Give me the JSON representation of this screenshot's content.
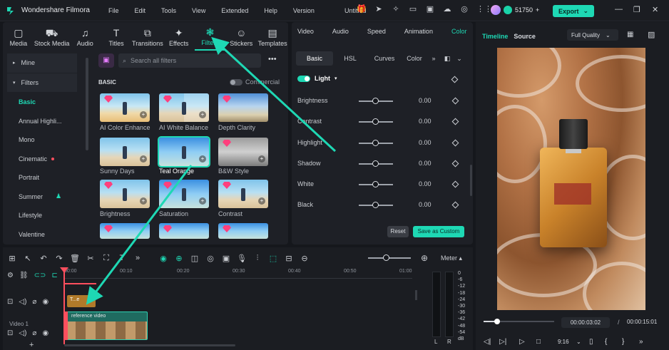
{
  "titlebar": {
    "app_name": "Wondershare Filmora",
    "menu": [
      "File",
      "Edit",
      "Tools",
      "View",
      "Extended",
      "Help",
      "Version"
    ],
    "doc_title": "Untitled",
    "credits": "51750",
    "export_label": "Export"
  },
  "media_tabs": [
    {
      "label": "Media",
      "icon": "media-icon"
    },
    {
      "label": "Stock Media",
      "icon": "stock-media-icon"
    },
    {
      "label": "Audio",
      "icon": "audio-icon"
    },
    {
      "label": "Titles",
      "icon": "titles-icon"
    },
    {
      "label": "Transitions",
      "icon": "transitions-icon"
    },
    {
      "label": "Effects",
      "icon": "effects-icon"
    },
    {
      "label": "Filters",
      "icon": "filters-icon"
    },
    {
      "label": "Stickers",
      "icon": "stickers-icon"
    },
    {
      "label": "Templates",
      "icon": "templates-icon"
    }
  ],
  "sidebar": {
    "mine": "Mine",
    "filters": "Filters",
    "items": [
      "Basic",
      "Annual Highli...",
      "Mono",
      "Cinematic",
      "Portrait",
      "Summer",
      "Lifestyle",
      "Valentine"
    ]
  },
  "filters_panel": {
    "search_placeholder": "Search all filters",
    "section": "BASIC",
    "commercial": "Commercial",
    "thumbs": [
      "AI Color Enhance",
      "AI White Balance",
      "Depth Clarity",
      "Sunny Days",
      "Teal Orange",
      "B&W Style",
      "Brightness",
      "Saturation",
      "Contrast"
    ]
  },
  "inspector": {
    "tabs": [
      "Video",
      "Audio",
      "Speed",
      "Animation",
      "Color"
    ],
    "sub_tabs": [
      "Basic",
      "HSL",
      "Curves",
      "Color"
    ],
    "light_label": "Light",
    "adjustments": [
      {
        "label": "Brightness",
        "value": "0.00"
      },
      {
        "label": "Contrast",
        "value": "0.00"
      },
      {
        "label": "Highlight",
        "value": "0.00"
      },
      {
        "label": "Shadow",
        "value": "0.00"
      },
      {
        "label": "White",
        "value": "0.00"
      },
      {
        "label": "Black",
        "value": "0.00"
      }
    ],
    "reset_label": "Reset",
    "save_custom_label": "Save as Custom"
  },
  "preview": {
    "tab_timeline": "Timeline",
    "tab_source": "Source",
    "quality": "Full Quality",
    "time_current": "00:00:03:02",
    "time_sep": "/",
    "time_total": "00:00:15:01",
    "aspect": "9:16",
    "progress": 0.2
  },
  "timeline": {
    "meter_label": "Meter",
    "ruler": [
      "00:00",
      "00:10",
      "00:20",
      "00:30",
      "00:40",
      "00:50",
      "01:00"
    ],
    "filter_clip_label": "T...e",
    "video_clip_label": "reference video",
    "video_track_label": "Video 1",
    "meter_scale": [
      "0",
      "-6",
      "-12",
      "-18",
      "-24",
      "-30",
      "-36",
      "-42",
      "-48",
      "-54",
      "dB"
    ],
    "meter_l": "L",
    "meter_r": "R"
  },
  "colors": {
    "accent": "#1ed8b4",
    "playhead": "#ff4f5e",
    "filter_clip": "#b07a2a"
  }
}
